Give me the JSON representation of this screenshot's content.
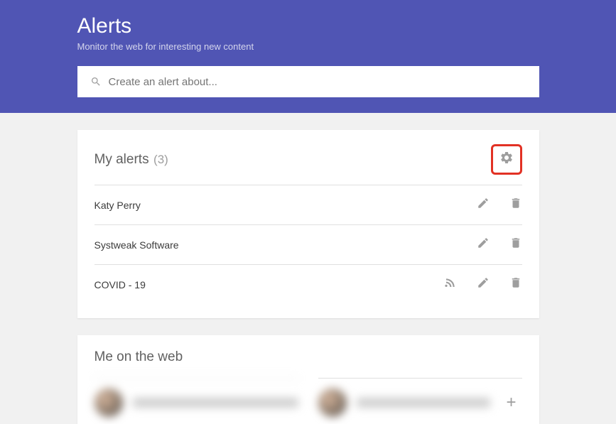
{
  "header": {
    "title": "Alerts",
    "subtitle": "Monitor the web for interesting new content"
  },
  "search": {
    "placeholder": "Create an alert about..."
  },
  "myAlerts": {
    "title": "My alerts",
    "count": "(3)",
    "items": [
      {
        "name": "Katy Perry",
        "hasRss": false
      },
      {
        "name": "Systweak Software",
        "hasRss": false
      },
      {
        "name": "COVID - 19",
        "hasRss": true
      }
    ]
  },
  "meOnWeb": {
    "title": "Me on the web"
  },
  "icons": {
    "gear": "gear-icon",
    "pencil": "pencil-icon",
    "trash": "trash-icon",
    "rss": "rss-icon",
    "search": "search-icon",
    "plus": "plus-icon"
  }
}
